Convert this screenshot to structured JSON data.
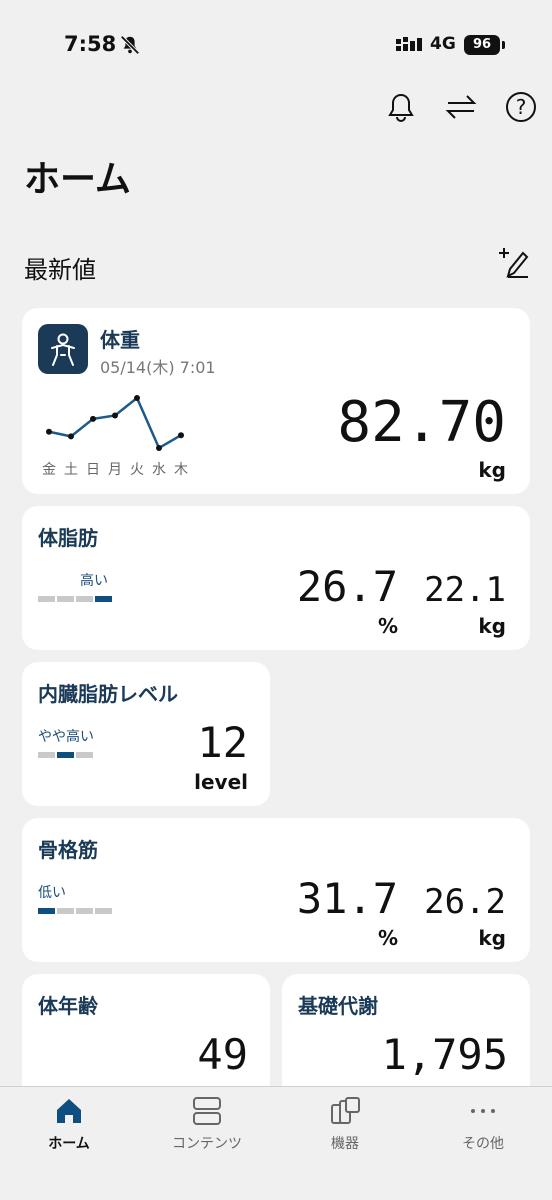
{
  "status": {
    "time": "7:58",
    "network": "4G",
    "battery": "96"
  },
  "page_title": "ホーム",
  "section_title": "最新値",
  "weight": {
    "title": "体重",
    "datetime": "05/14(木) 7:01",
    "value": "82.70",
    "unit": "kg",
    "days": [
      "金",
      "土",
      "日",
      "月",
      "火",
      "水",
      "木"
    ],
    "chart_points": [
      81.9,
      81.5,
      83.0,
      83.3,
      84.8,
      80.5,
      81.6
    ]
  },
  "body_fat": {
    "title": "体脂肪",
    "level": "高い",
    "level_index": 3,
    "percent": "26.7",
    "percent_unit": "%",
    "kg": "22.1",
    "kg_unit": "kg"
  },
  "visceral": {
    "title": "内臓脂肪レベル",
    "level": "やや高い",
    "level_index": 1,
    "value": "12",
    "unit": "level"
  },
  "skeletal": {
    "title": "骨格筋",
    "level": "低い",
    "level_index": 0,
    "percent": "31.7",
    "percent_unit": "%",
    "kg": "26.2",
    "kg_unit": "kg"
  },
  "body_age": {
    "title": "体年齢",
    "value": "49"
  },
  "bmr": {
    "title": "基礎代謝",
    "value": "1,795"
  },
  "nav": [
    {
      "label": "ホーム",
      "icon": "home-icon",
      "active": true
    },
    {
      "label": "コンテンツ",
      "icon": "contents-icon",
      "active": false
    },
    {
      "label": "機器",
      "icon": "devices-icon",
      "active": false
    },
    {
      "label": "その他",
      "icon": "more-icon",
      "active": false
    }
  ],
  "colors": {
    "accent": "#0e4f80",
    "title": "#1b3a57",
    "background": "#f0f0f0"
  }
}
